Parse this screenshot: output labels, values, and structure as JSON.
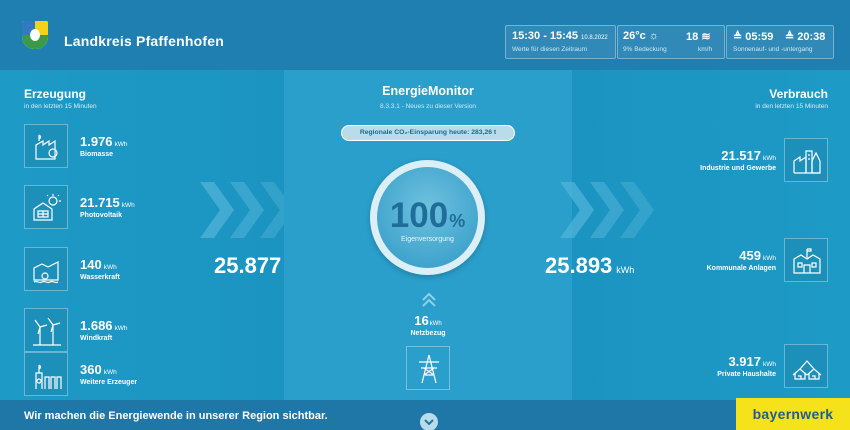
{
  "header": {
    "title": "Landkreis Pfaffenhofen",
    "period": {
      "time": "15:30 - 15:45",
      "date": "10.8.2022",
      "label": "Werte für diesen Zeitraum"
    },
    "weather": {
      "temp": "26°c",
      "cover": "9% Bedeckung",
      "wind": "18",
      "wind_unit": "km/h"
    },
    "sun": {
      "rise": "05:59",
      "set": "20:38",
      "label": "Sonnenauf- und -untergang"
    }
  },
  "left": {
    "title": "Erzeugung",
    "subtitle": "in den letzten 15 Minuten",
    "items": [
      {
        "value": "1.976",
        "unit": "kWh",
        "label": "Biomasse",
        "icon": "biomass-icon"
      },
      {
        "value": "21.715",
        "unit": "kWh",
        "label": "Photovoltaik",
        "icon": "solar-icon"
      },
      {
        "value": "140",
        "unit": "kWh",
        "label": "Wasserkraft",
        "icon": "hydro-icon"
      },
      {
        "value": "1.686",
        "unit": "kWh",
        "label": "Windkraft",
        "icon": "wind-icon"
      },
      {
        "value": "360",
        "unit": "kWh",
        "label": "Weitere Erzeuger",
        "icon": "other-producer-icon"
      }
    ],
    "total": "25.877",
    "total_unit": "kWh"
  },
  "center": {
    "title": "EnergieMonitor",
    "version": "8.3.3.1 - Neues zu dieser Version",
    "co2": "Regionale CO₂-Einsparung heute: 283,26 t",
    "percent": "100",
    "percent_sign": "%",
    "percent_label": "Eigenversorgung",
    "grid_value": "16",
    "grid_unit": "kWh",
    "grid_label": "Netzbezug"
  },
  "right": {
    "title": "Verbrauch",
    "subtitle": "in den letzten 15 Minuten",
    "items": [
      {
        "value": "21.517",
        "unit": "kWh",
        "label": "Industrie und Gewerbe",
        "icon": "industry-icon"
      },
      {
        "value": "459",
        "unit": "kWh",
        "label": "Kommunale Anlagen",
        "icon": "municipal-icon"
      },
      {
        "value": "3.917",
        "unit": "kWh",
        "label": "Private Haushalte",
        "icon": "household-icon"
      }
    ],
    "total": "25.893",
    "total_unit": "kWh"
  },
  "footer": {
    "text": "Wir machen die Energiewende in unserer Region sichtbar.",
    "brand": "bayernwerk"
  },
  "colors": {
    "header": "#1f7fb0",
    "main": "#1d96c3",
    "footer": "#1e77a7",
    "brand_bg": "#f6e21a",
    "brand_text": "#1c5e96",
    "percent_text": "#1f6e99"
  }
}
